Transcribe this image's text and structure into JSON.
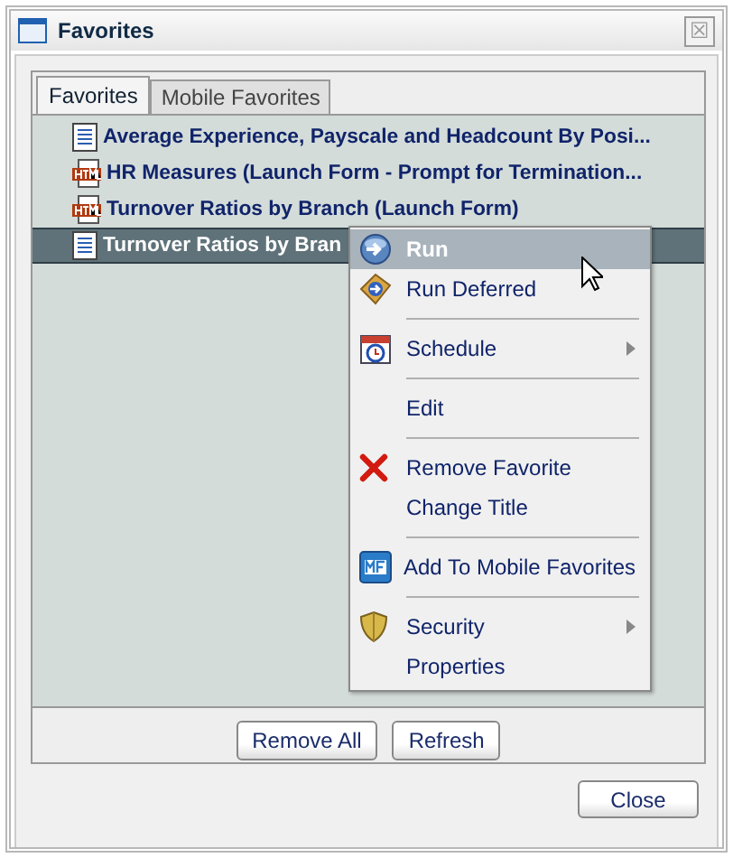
{
  "window": {
    "title": "Favorites",
    "close_glyph": "☒"
  },
  "tabs": [
    {
      "label": "Favorites",
      "selected": true
    },
    {
      "label": "Mobile Favorites",
      "selected": false
    }
  ],
  "favorites": [
    {
      "kind": "report",
      "title": "Average Experience, Payscale and Headcount By Posi...",
      "selected": false
    },
    {
      "kind": "html",
      "title": "HR Measures (Launch Form - Prompt for Termination...",
      "selected": false
    },
    {
      "kind": "html",
      "title": "Turnover Ratios by Branch (Launch Form)",
      "selected": false
    },
    {
      "kind": "report",
      "title": "Turnover Ratios by Bran",
      "selected": true
    }
  ],
  "context_menu": [
    {
      "kind": "item",
      "label": "Run",
      "selected": true,
      "submenu": false
    },
    {
      "kind": "item",
      "label": "Run Deferred",
      "selected": false,
      "submenu": false
    },
    {
      "kind": "separator"
    },
    {
      "kind": "item",
      "label": "Schedule",
      "selected": false,
      "submenu": true
    },
    {
      "kind": "separator"
    },
    {
      "kind": "item",
      "label": "Edit",
      "selected": false,
      "submenu": false
    },
    {
      "kind": "separator"
    },
    {
      "kind": "item",
      "label": "Remove Favorite",
      "selected": false,
      "submenu": false
    },
    {
      "kind": "item",
      "label": "Change Title",
      "selected": false,
      "submenu": false
    },
    {
      "kind": "separator"
    },
    {
      "kind": "item",
      "label": "Add To Mobile Favorites",
      "selected": false,
      "submenu": false
    },
    {
      "kind": "separator"
    },
    {
      "kind": "item",
      "label": "Security",
      "selected": false,
      "submenu": true
    },
    {
      "kind": "item",
      "label": "Properties",
      "selected": false,
      "submenu": false
    }
  ],
  "panel_buttons": [
    "Remove All",
    "Refresh"
  ],
  "dialog_buttons": [
    "Close"
  ]
}
